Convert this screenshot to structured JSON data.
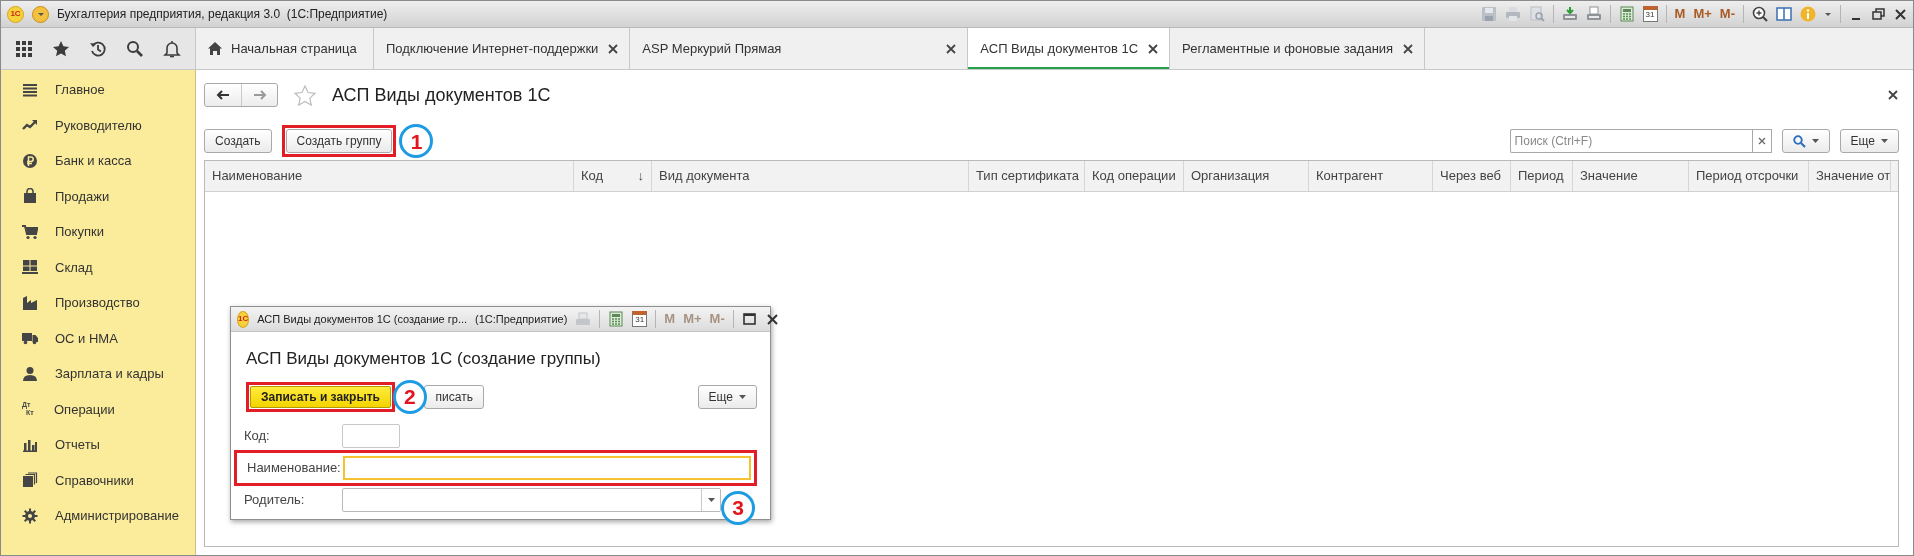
{
  "window": {
    "logo": "1С",
    "title": "Бухгалтерия предприятия, редакция 3.0  (1С:Предприятие)",
    "calendar_day": "31",
    "memory_buttons": [
      {
        "label": "M",
        "disabled": false
      },
      {
        "label": "M+",
        "disabled": false
      },
      {
        "label": "M-",
        "disabled": false
      }
    ]
  },
  "tabs": [
    {
      "label": "Начальная страница",
      "kind": "home",
      "selected": false,
      "closable": false
    },
    {
      "label": "Подключение Интернет-поддержки",
      "kind": "page",
      "selected": false,
      "closable": true
    },
    {
      "label": "ASP Меркурий Прямая",
      "kind": "page",
      "selected": false,
      "closable": true
    },
    {
      "label": "АСП Виды документов 1С",
      "kind": "page",
      "selected": true,
      "closable": true
    },
    {
      "label": "Регламентные и фоновые задания",
      "kind": "page",
      "selected": false,
      "closable": true
    }
  ],
  "sidebar": {
    "items": [
      {
        "label": "Главное"
      },
      {
        "label": "Руководителю"
      },
      {
        "label": "Банк и касса"
      },
      {
        "label": "Продажи"
      },
      {
        "label": "Покупки"
      },
      {
        "label": "Склад"
      },
      {
        "label": "Производство"
      },
      {
        "label": "ОС и НМА"
      },
      {
        "label": "Зарплата и кадры"
      },
      {
        "label": "Операции",
        "icon_text": [
          "Дт",
          "Кт"
        ]
      },
      {
        "label": "Отчеты"
      },
      {
        "label": "Справочники"
      },
      {
        "label": "Администрирование"
      }
    ]
  },
  "form": {
    "title": "АСП Виды документов 1С",
    "favorite": false,
    "buttons": [
      {
        "label": "Создать",
        "highlighted": false
      },
      {
        "label": "Создать группу",
        "highlighted": true,
        "callout": "1"
      }
    ],
    "search": {
      "placeholder": "Поиск (Ctrl+F)"
    },
    "more": "Еще"
  },
  "table": {
    "columns": [
      {
        "label": "Наименование"
      },
      {
        "label": "Код",
        "sort_indicator": "↓"
      },
      {
        "label": "Вид документа"
      },
      {
        "label": "Тип сертификата"
      },
      {
        "label": "Код операции"
      },
      {
        "label": "Организация"
      },
      {
        "label": "Контрагент"
      },
      {
        "label": "Через веб"
      },
      {
        "label": "Период"
      },
      {
        "label": "Значение"
      },
      {
        "label": "Период отсрочки"
      },
      {
        "label": "Значение от"
      }
    ]
  },
  "dialog": {
    "logo": "1С",
    "title": "АСП Виды документов 1С (создание гр...",
    "app": "(1С:Предприятие)",
    "calendar_day": "31",
    "memory_buttons": [
      {
        "label": "M",
        "disabled": true
      },
      {
        "label": "M+",
        "disabled": true
      },
      {
        "label": "M-",
        "disabled": true
      }
    ],
    "heading": "АСП Виды документов 1С (создание группы)",
    "buttons": [
      {
        "label": "Записать и закрыть",
        "kind": "primary",
        "highlighted": true,
        "callout": "2"
      },
      {
        "label": "писать",
        "kind": "default",
        "highlighted": false
      }
    ],
    "more": "Еще",
    "fields": [
      {
        "label": "Код:",
        "kind": "short_text",
        "focused": false,
        "highlighted": false
      },
      {
        "label": "Наименование:",
        "kind": "text",
        "focused": true,
        "highlighted": true
      },
      {
        "label": "Родитель:",
        "kind": "dropdown",
        "focused": false,
        "highlighted": false,
        "callout": "3"
      }
    ]
  }
}
